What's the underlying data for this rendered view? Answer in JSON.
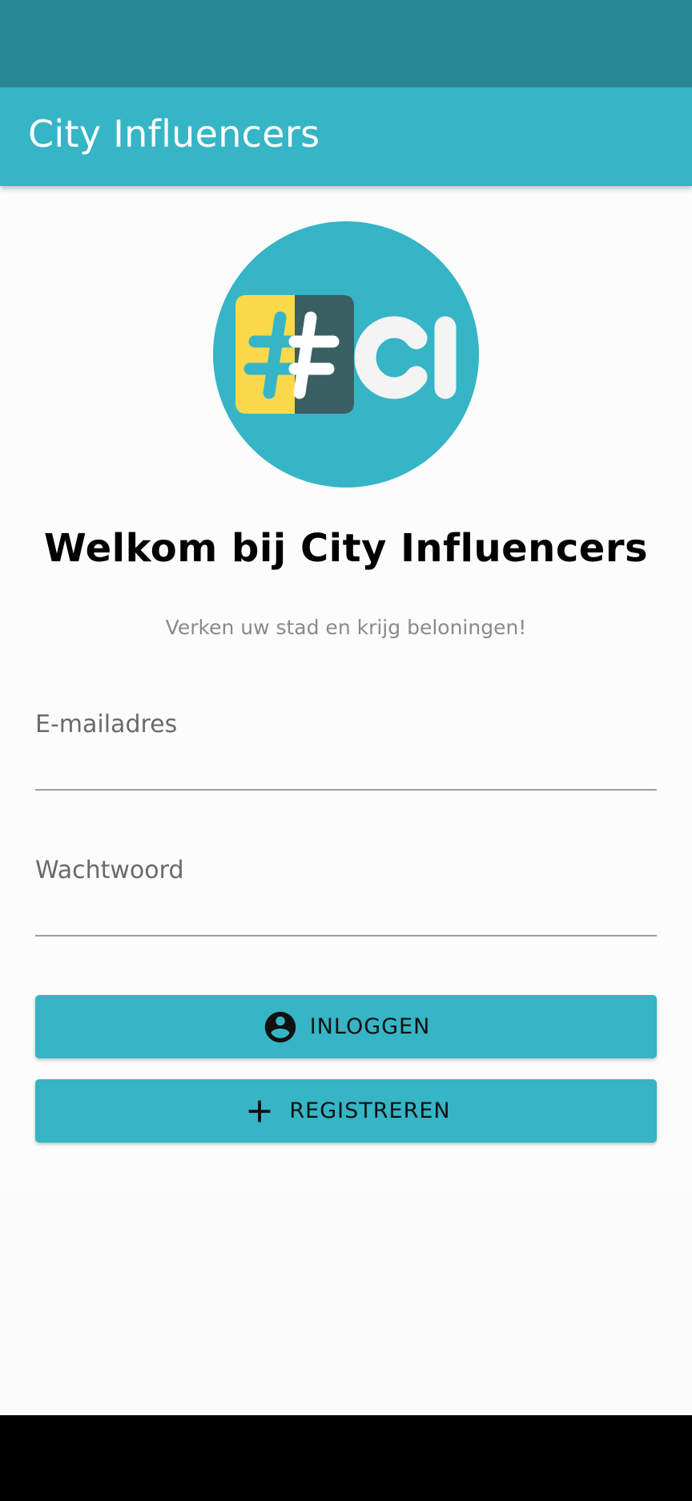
{
  "app_bar": {
    "title": "City Influencers"
  },
  "logo": {
    "text": "CI",
    "symbol": "#",
    "icon": "city-influencers-logo"
  },
  "welcome": {
    "title": "Welkom bij City Influencers",
    "subtitle": "Verken uw stad en krijg beloningen!"
  },
  "form": {
    "email": {
      "label": "E-mailadres",
      "value": ""
    },
    "password": {
      "label": "Wachtwoord",
      "value": ""
    }
  },
  "buttons": {
    "login": {
      "label": "INLOGGEN",
      "icon": "account-circle-icon"
    },
    "register": {
      "label": "REGISTREREN",
      "icon": "plus-icon"
    }
  },
  "colors": {
    "status_bar": "#288893",
    "primary": "#35b5c6",
    "logo_yellow": "#fbd94a",
    "logo_dark": "#3a5f63"
  }
}
